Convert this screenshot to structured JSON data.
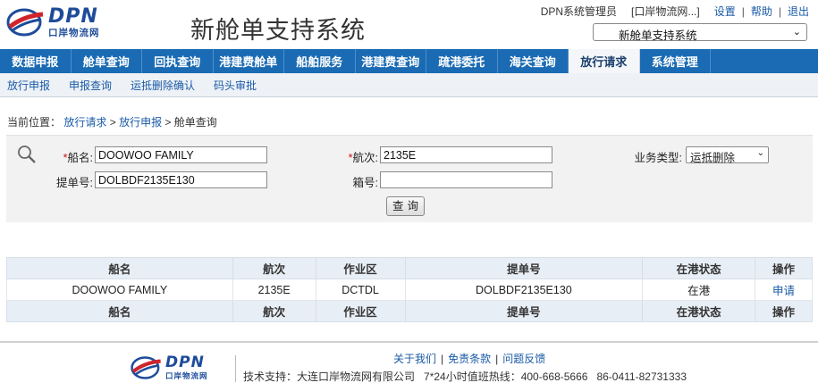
{
  "header": {
    "logo_text": "DPN",
    "logo_subtext": "口岸物流网",
    "system_title": "新舱单支持系统",
    "user": "DPN系统管理员",
    "company": "[口岸物流网...]",
    "links": [
      "设置",
      "帮助",
      "退出"
    ],
    "system_select_value": "新舱单支持系统"
  },
  "main_nav": {
    "items": [
      "数据申报",
      "舱单查询",
      "回执查询",
      "港建费舱单",
      "船舶服务",
      "港建费查询",
      "疏港委托",
      "海关查询",
      "放行请求",
      "系统管理"
    ],
    "active": "放行请求"
  },
  "sub_nav": {
    "items": [
      "放行申报",
      "申报查询",
      "运抵删除确认",
      "码头审批"
    ]
  },
  "breadcrumb": {
    "prefix": "当前位置：",
    "items": [
      "放行请求",
      "放行申报"
    ],
    "current": "> 舱单查询"
  },
  "search": {
    "required_mark": "*",
    "ship_name_label": "船名:",
    "ship_name_value": "DOOWOO FAMILY",
    "voyage_label": "航次:",
    "voyage_value": "2135E",
    "biz_type_label": "业务类型:",
    "biz_type_value": "运抵删除",
    "bl_label": "提单号:",
    "bl_value": "DOLBDF2135E130",
    "box_label": "箱号:",
    "box_value": "",
    "query_button": "查询"
  },
  "table": {
    "columns": [
      "船名",
      "航次",
      "作业区",
      "提单号",
      "在港状态",
      "操作"
    ],
    "rows": [
      [
        "DOOWOO FAMILY",
        "2135E",
        "DCTDL",
        "DOLBDF2135E130",
        "在港",
        "申请"
      ]
    ]
  },
  "footer": {
    "links": [
      "关于我们",
      "免责条款",
      "问题反馈"
    ],
    "support_label": "技术支持：大连口岸物流网有限公司",
    "hotline": "7*24小时值班热线：400-668-5666",
    "phone": "86-0411-82731333"
  },
  "colors": {
    "nav_blue": "#1a6bb3",
    "link_blue": "#1a5aa6",
    "required_red": "#d01010"
  }
}
